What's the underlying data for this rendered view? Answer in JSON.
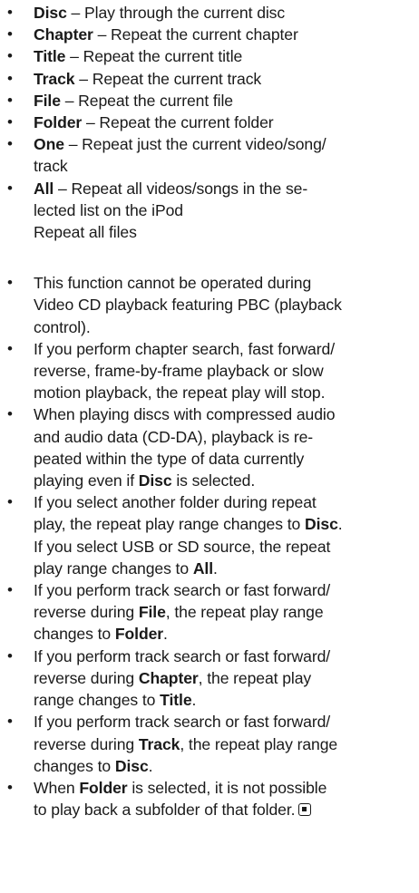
{
  "modes": [
    {
      "term": "Disc",
      "desc": " – Play through the current disc"
    },
    {
      "term": "Chapter",
      "desc": " – Repeat the current chapter"
    },
    {
      "term": "Title",
      "desc": " – Repeat the current title"
    },
    {
      "term": "Track",
      "desc": " – Repeat the current track"
    },
    {
      "term": "File",
      "desc": " – Repeat the current file"
    },
    {
      "term": "Folder",
      "desc": " – Repeat the current folder"
    },
    {
      "term": "One",
      "desc": " – Repeat just the current video/song/",
      "line2": "track"
    },
    {
      "term": "All",
      "desc": " – Repeat all videos/songs in the se-",
      "line2": "lected list on the iPod",
      "line3": "Repeat all files"
    }
  ],
  "notes": {
    "n1": {
      "l1": "This function cannot be operated during",
      "l2": "Video CD playback featuring PBC (playback",
      "l3": "control)."
    },
    "n2": {
      "l1": "If you perform chapter search, fast forward/",
      "l2": "reverse, frame-by-frame playback or slow",
      "l3": "motion playback, the repeat play will stop."
    },
    "n3": {
      "l1": "When playing discs with compressed audio",
      "l2": "and audio data (CD-DA), playback is re-",
      "l3": "peated within the type of data currently",
      "l4a": "playing even if ",
      "l4b": "Disc",
      "l4c": " is selected."
    },
    "n4": {
      "l1": "If you select another folder during repeat",
      "l2a": "play, the repeat play range changes to ",
      "l2b": "Disc",
      "l2c": ".",
      "l3": "If you select USB or SD source, the repeat",
      "l4a": "play range changes to ",
      "l4b": "All",
      "l4c": "."
    },
    "n5": {
      "l1": "If you perform track search or fast forward/",
      "l2a": "reverse during ",
      "l2b": "File",
      "l2c": ", the repeat play range",
      "l3a": "changes to ",
      "l3b": "Folder",
      "l3c": "."
    },
    "n6": {
      "l1": "If you perform track search or fast forward/",
      "l2a": "reverse during ",
      "l2b": "Chapter",
      "l2c": ", the repeat play",
      "l3a": "range changes to ",
      "l3b": "Title",
      "l3c": "."
    },
    "n7": {
      "l1": "If you perform track search or fast forward/",
      "l2a": "reverse during ",
      "l2b": "Track",
      "l2c": ", the repeat play range",
      "l3a": "changes to ",
      "l3b": "Disc",
      "l3c": "."
    },
    "n8": {
      "l1a": "When ",
      "l1b": "Folder",
      "l1c": " is selected, it is not possible",
      "l2": "to play back a subfolder of that folder."
    }
  },
  "end_mark_icon": "stop-square-icon"
}
